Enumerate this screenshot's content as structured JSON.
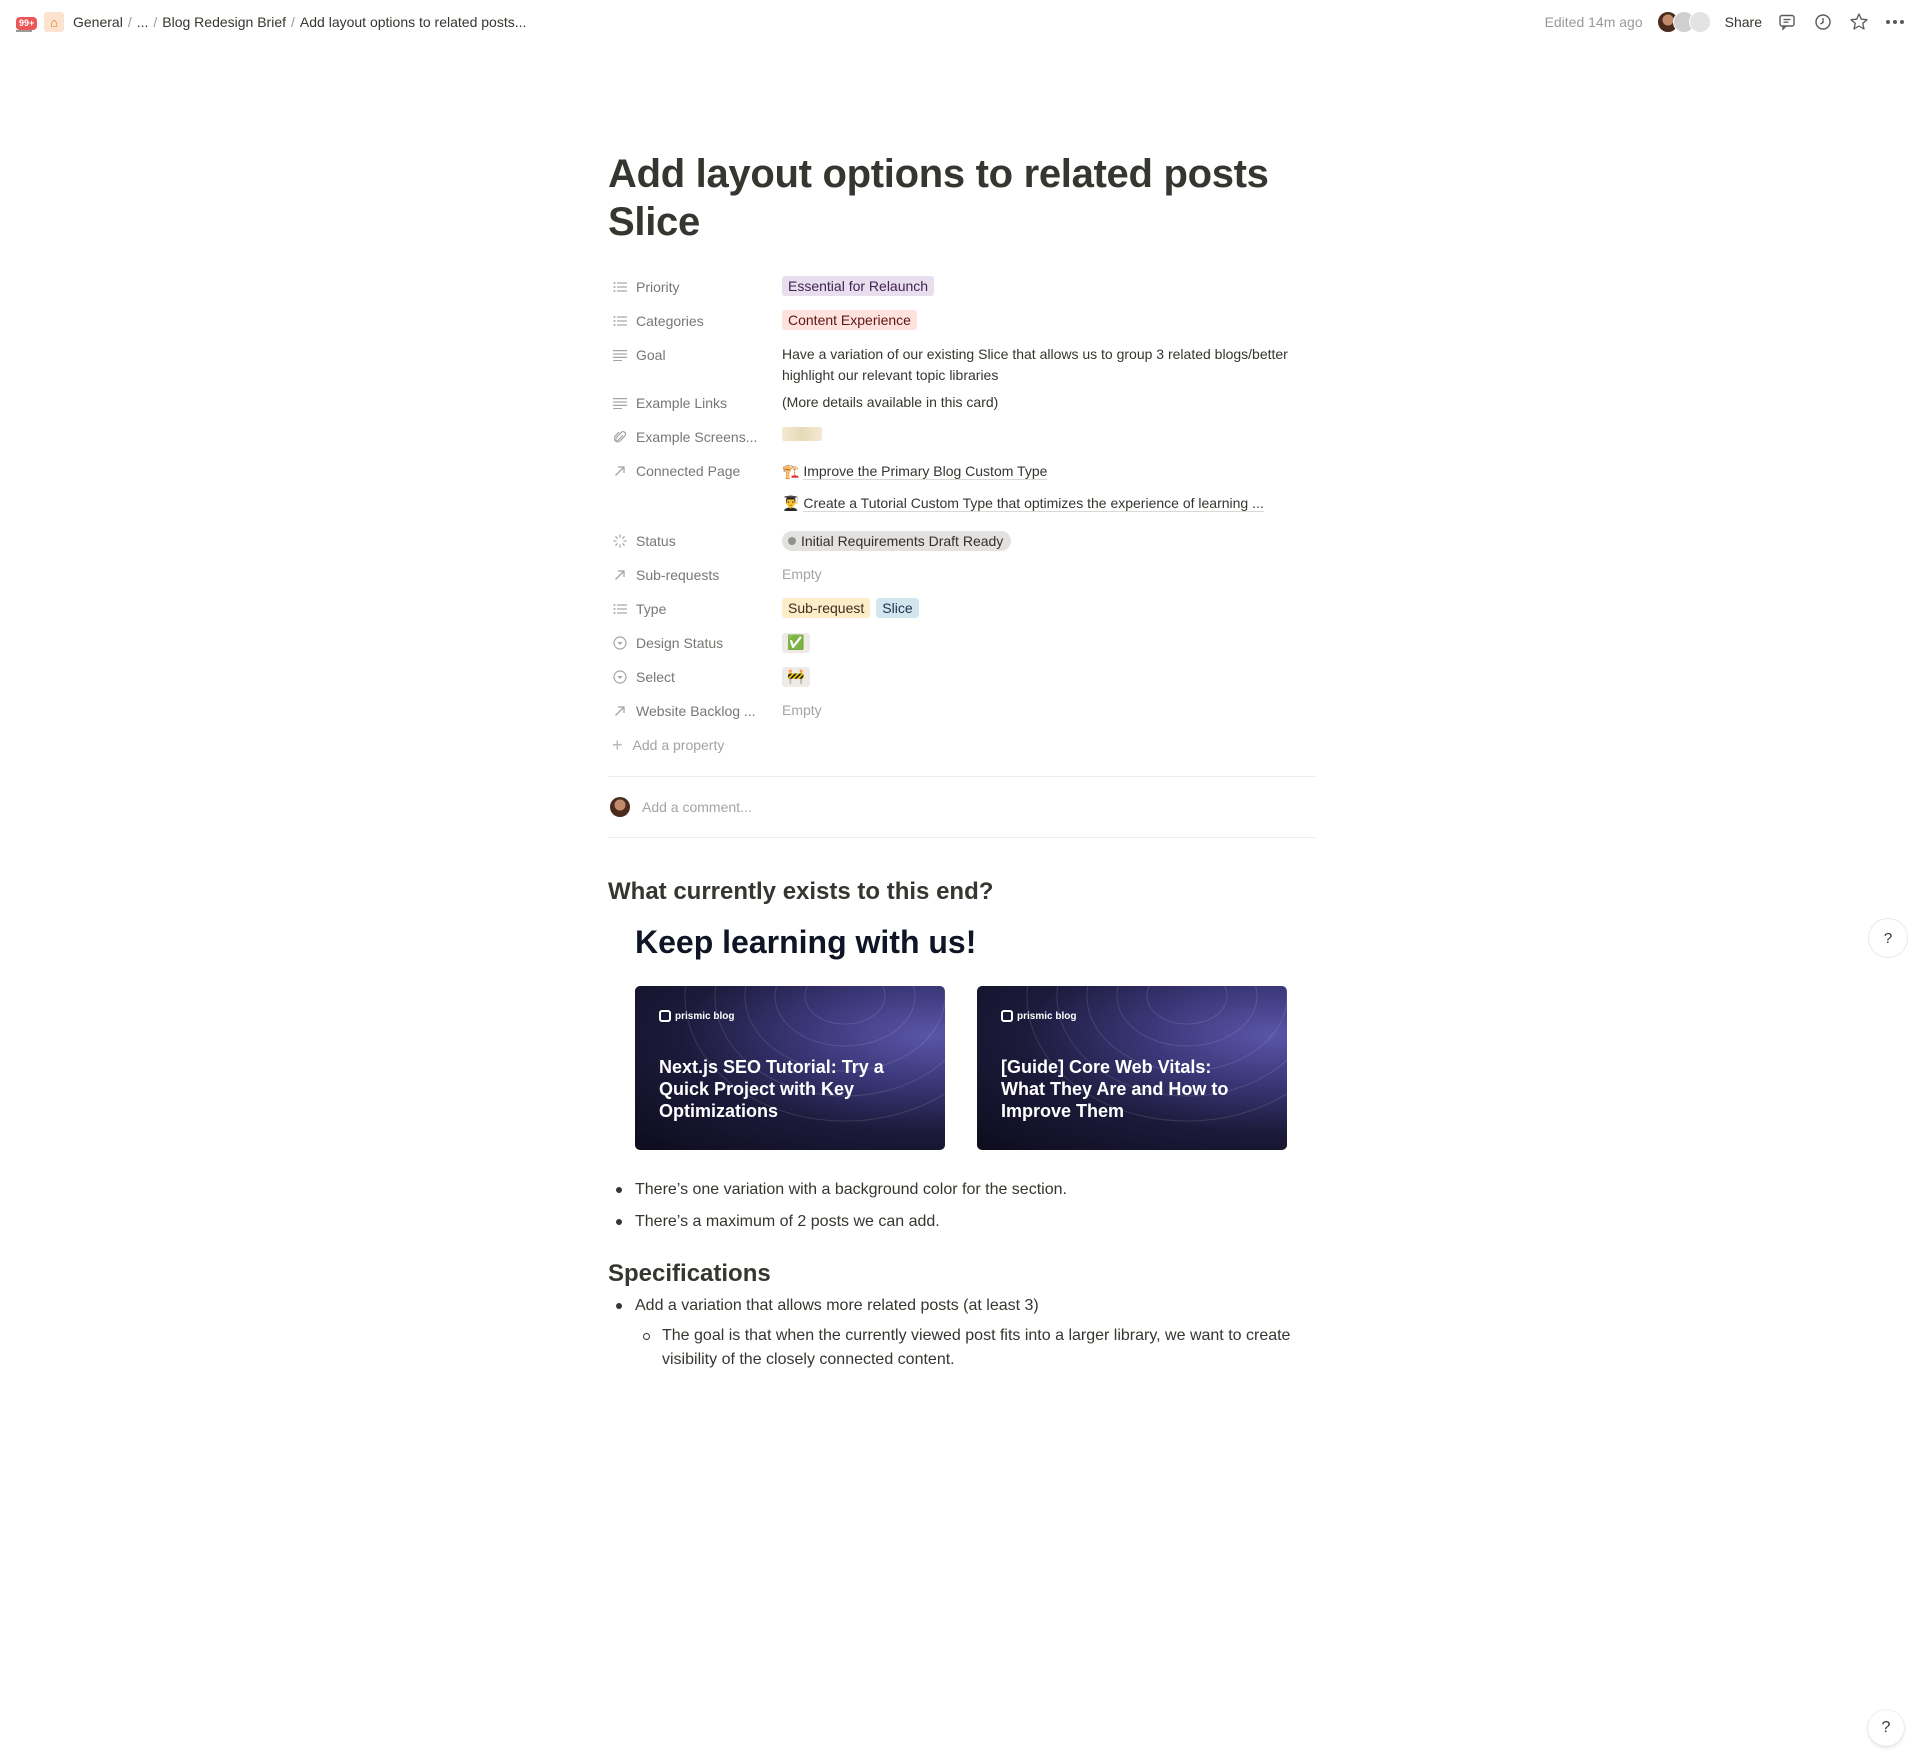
{
  "topbar": {
    "notification_badge": "99+",
    "breadcrumbs": [
      "General",
      "...",
      "Blog Redesign Brief",
      "Add layout options to related posts..."
    ],
    "edited": "Edited 14m ago",
    "share_label": "Share",
    "icons": [
      "comment-icon",
      "history-clock-icon",
      "favorite-star-icon",
      "more-ellipsis-icon"
    ]
  },
  "page": {
    "title": "Add layout options to related posts Slice",
    "properties": [
      {
        "label": "Priority",
        "icon": "list-icon",
        "tags": [
          {
            "text": "Essential for Relaunch",
            "color": "#e8deee"
          }
        ]
      },
      {
        "label": "Categories",
        "icon": "list-icon",
        "tags": [
          {
            "text": "Content Experience",
            "color": "#ffe2dd"
          }
        ]
      },
      {
        "label": "Goal",
        "icon": "text-icon",
        "text": "Have a variation of our existing Slice that allows us to group 3 related blogs/better highlight our relevant topic libraries"
      },
      {
        "label": "Example Links",
        "icon": "text-icon",
        "text": "(More details available in this card)"
      },
      {
        "label": "Example Screens...",
        "icon": "paperclip-icon",
        "thumbnail": "screenshot-thumbnail"
      },
      {
        "label": "Connected Page",
        "icon": "relation-arrow-icon",
        "links": [
          {
            "emoji": "🏗️",
            "text": "Improve the Primary Blog Custom Type"
          },
          {
            "emoji": "👨‍🎓",
            "text": "Create a Tutorial Custom Type that optimizes the experience of learning ..."
          }
        ]
      },
      {
        "label": "Status",
        "icon": "status-icon",
        "status": "Initial Requirements Draft Ready"
      },
      {
        "label": "Sub-requests",
        "icon": "relation-arrow-icon",
        "empty": "Empty"
      },
      {
        "label": "Type",
        "icon": "list-icon",
        "tags": [
          {
            "text": "Sub-request",
            "color": "#fdecc8"
          },
          {
            "text": "Slice",
            "color": "#d3e5ef"
          }
        ]
      },
      {
        "label": "Design Status",
        "icon": "select-icon",
        "emoji": "✅"
      },
      {
        "label": "Select",
        "icon": "select-icon",
        "emoji": "🚧"
      },
      {
        "label": "Website Backlog ...",
        "icon": "relation-arrow-icon",
        "empty": "Empty"
      }
    ],
    "add_property": "Add a property",
    "comment_placeholder": "Add a comment..."
  },
  "content": {
    "heading_exists": "What currently exists to this end?",
    "embed": {
      "title": "Keep learning with us!",
      "logo_text": "prismic blog",
      "cards": [
        {
          "title": "Next.js SEO Tutorial: Try a Quick Project with Key Optimizations"
        },
        {
          "title": "[Guide] Core Web Vitals: What They Are and How to Improve Them"
        }
      ]
    },
    "bullets": [
      "There’s one variation with a background color for the section.",
      "There’s a maximum of 2 posts we can add."
    ],
    "heading_spec": "Specifications",
    "spec_bullets": [
      {
        "text": "Add a variation that allows more related posts (at least 3)",
        "sub": [
          "The goal is that when the currently viewed post fits into a larger library, we want to create visibility of the closely connected content."
        ]
      }
    ]
  },
  "help": {
    "label": "?"
  }
}
